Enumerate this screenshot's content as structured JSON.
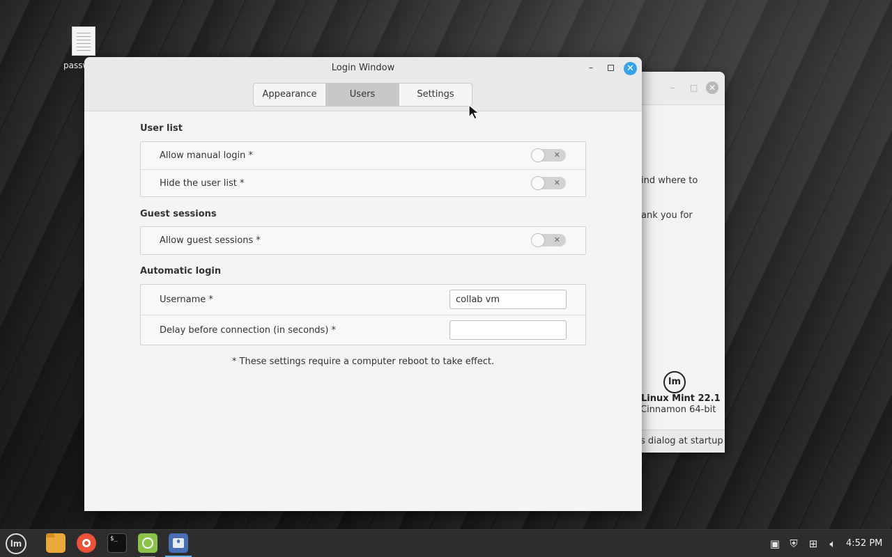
{
  "desktop": {
    "icon_label": "passwords.txt"
  },
  "background_window": {
    "text_line1": "ind where to",
    "text_line2": "ank you for",
    "distro_name": "Linux Mint 22.1",
    "edition": "Cinnamon 64-bit",
    "footer_text": "s dialog at startup",
    "logo_text": "lm"
  },
  "window": {
    "title": "Login Window",
    "minimize_glyph": "–",
    "close_glyph": "✕",
    "tabs": [
      {
        "label": "Appearance",
        "active": false
      },
      {
        "label": "Users",
        "active": true
      },
      {
        "label": "Settings",
        "active": false
      }
    ]
  },
  "sections": {
    "user_list": {
      "title": "User list",
      "rows": [
        {
          "label": "Allow manual login *",
          "enabled": false
        },
        {
          "label": "Hide the user list *",
          "enabled": false
        }
      ]
    },
    "guest_sessions": {
      "title": "Guest sessions",
      "rows": [
        {
          "label": "Allow guest sessions *",
          "enabled": false
        }
      ]
    },
    "automatic_login": {
      "title": "Automatic login",
      "username_label": "Username *",
      "username_value": "collab vm",
      "delay_label": "Delay before connection (in seconds) *",
      "delay_value": ""
    }
  },
  "note": "* These settings require a computer reboot to take effect.",
  "toggle_off_glyph": "✕",
  "taskbar": {
    "menu_logo_text": "lm",
    "terminal_glyph": "$_",
    "clock": "4:52 PM"
  },
  "colors": {
    "accent": "#35a3e6",
    "active_tab": "#c8c8c8",
    "taskbar": "#2d2d2d"
  }
}
